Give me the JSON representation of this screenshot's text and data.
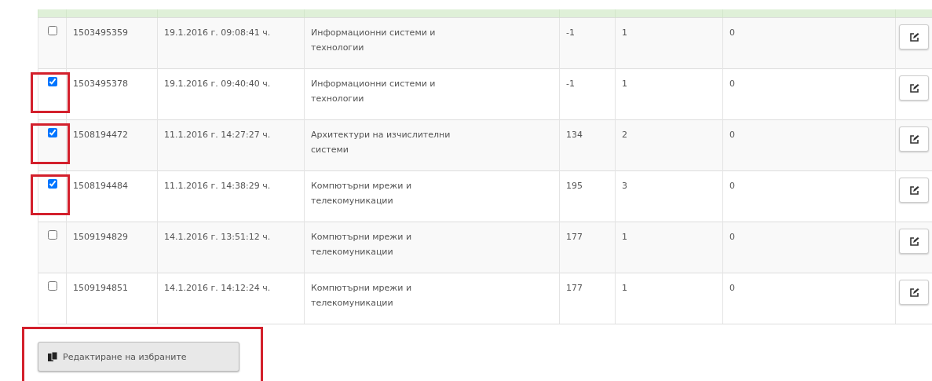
{
  "table": {
    "rows": [
      {
        "checked": false,
        "highlighted": false,
        "cells": [
          "1503495359",
          "19.1.2016 г. 09:08:41 ч.",
          "Информационни системи и технологии",
          "-1",
          "1",
          "0"
        ]
      },
      {
        "checked": true,
        "highlighted": true,
        "cells": [
          "1503495378",
          "19.1.2016 г. 09:40:40 ч.",
          "Информационни системи и технологии",
          "-1",
          "1",
          "0"
        ]
      },
      {
        "checked": true,
        "highlighted": true,
        "cells": [
          "1508194472",
          "11.1.2016 г. 14:27:27 ч.",
          "Архитектури на изчислителни системи",
          "134",
          "2",
          "0"
        ]
      },
      {
        "checked": true,
        "highlighted": true,
        "cells": [
          "1508194484",
          "11.1.2016 г. 14:38:29 ч.",
          "Компютърни мрежи и телекомуникации",
          "195",
          "3",
          "0"
        ]
      },
      {
        "checked": false,
        "highlighted": false,
        "cells": [
          "1509194829",
          "14.1.2016 г. 13:51:12 ч.",
          "Компютърни мрежи и телекомуникации",
          "177",
          "1",
          "0"
        ]
      },
      {
        "checked": false,
        "highlighted": false,
        "cells": [
          "1509194851",
          "14.1.2016 г. 14:12:24 ч.",
          "Компютърни мрежи и телекомуникации",
          "177",
          "1",
          "0"
        ]
      }
    ]
  },
  "edit_selected_button": {
    "label": "Редактиране на избраните",
    "highlighted": true
  }
}
